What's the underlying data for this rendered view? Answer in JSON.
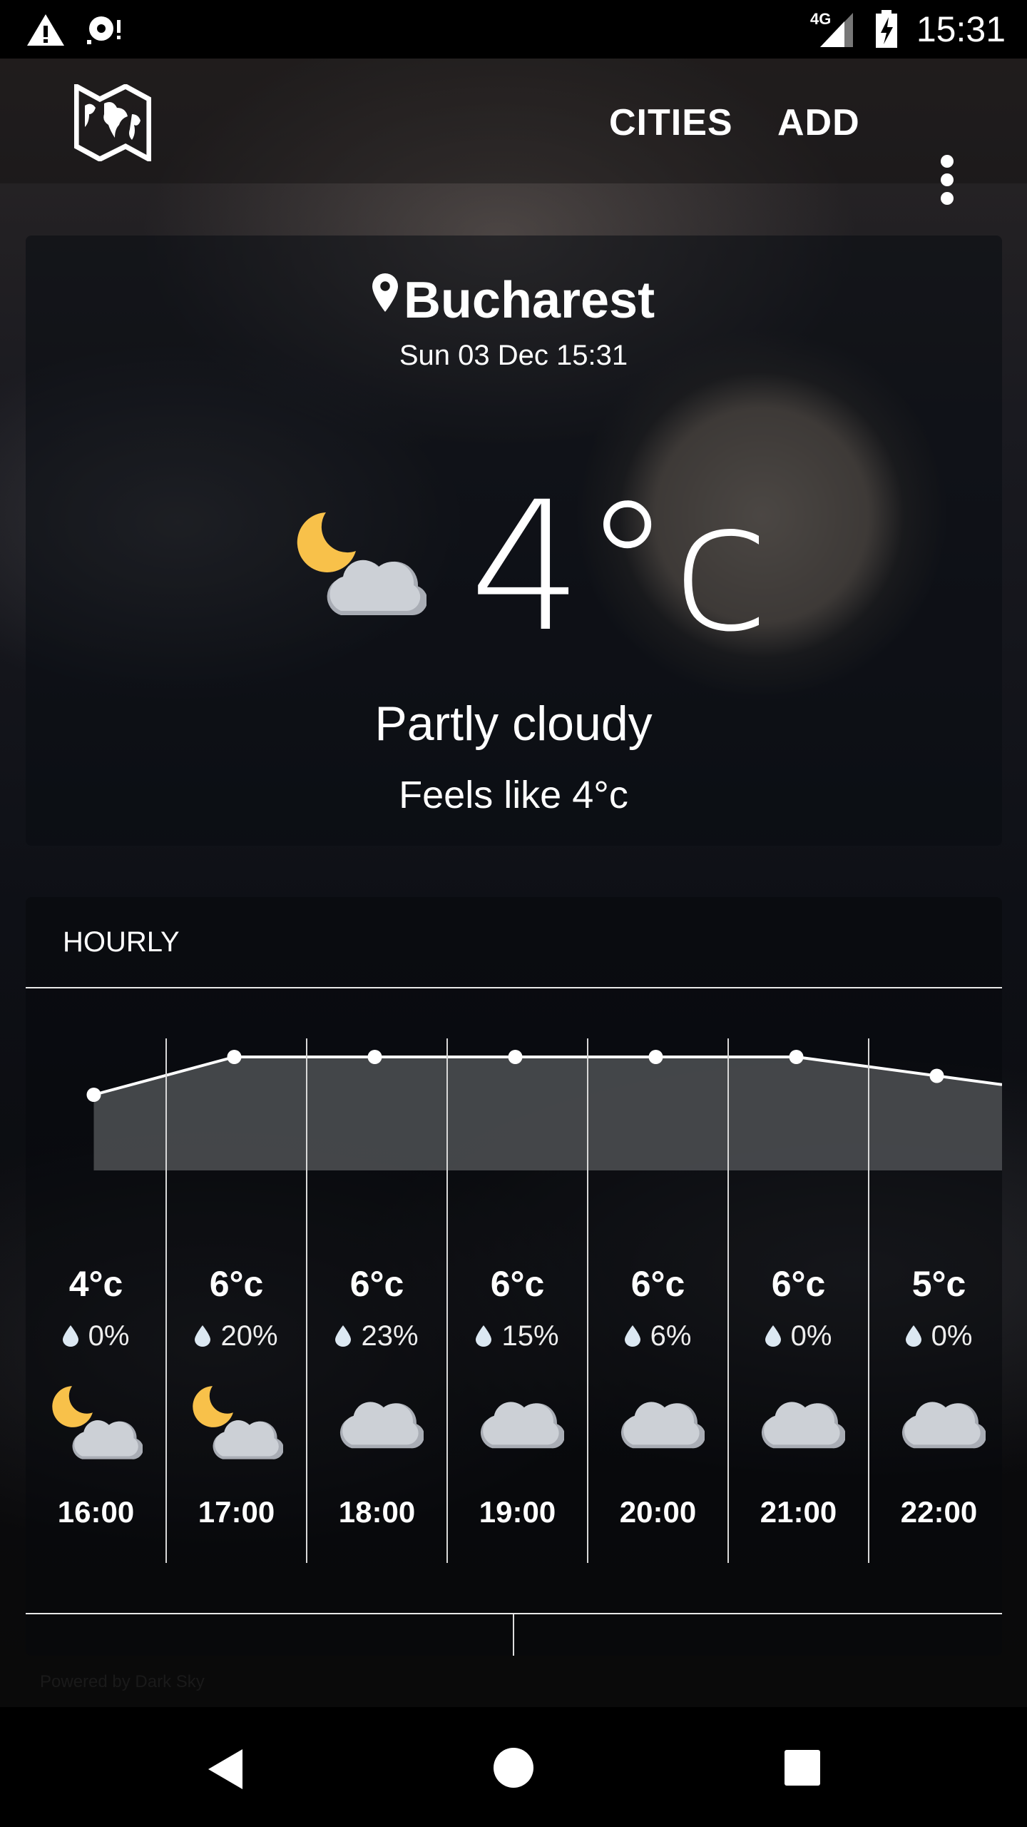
{
  "status_bar": {
    "time": "15:31",
    "network": "4G",
    "icons": [
      "warning-icon",
      "sync-alert-icon",
      "signal-icon",
      "battery-charging-icon"
    ]
  },
  "toolbar": {
    "logo": "world-map-icon",
    "cities_label": "CITIES",
    "add_label": "ADD",
    "menu_icon": "more-vert-icon"
  },
  "current": {
    "city": "Bucharest",
    "datetime": "Sun 03 Dec 15:31",
    "temperature": "4°c",
    "summary": "Partly cloudy",
    "feels_like": "Feels like 4°c",
    "icon": "partly-cloudy-night"
  },
  "hourly": {
    "label": "HOURLY",
    "items": [
      {
        "time": "16:00",
        "temp": "4°c",
        "temp_value": 4,
        "precip": "0%",
        "icon": "partly-cloudy-night"
      },
      {
        "time": "17:00",
        "temp": "6°c",
        "temp_value": 6,
        "precip": "20%",
        "icon": "partly-cloudy-night"
      },
      {
        "time": "18:00",
        "temp": "6°c",
        "temp_value": 6,
        "precip": "23%",
        "icon": "cloudy"
      },
      {
        "time": "19:00",
        "temp": "6°c",
        "temp_value": 6,
        "precip": "15%",
        "icon": "cloudy"
      },
      {
        "time": "20:00",
        "temp": "6°c",
        "temp_value": 6,
        "precip": "6%",
        "icon": "cloudy"
      },
      {
        "time": "21:00",
        "temp": "6°c",
        "temp_value": 6,
        "precip": "0%",
        "icon": "cloudy"
      },
      {
        "time": "22:00",
        "temp": "5°c",
        "temp_value": 5,
        "precip": "0%",
        "icon": "cloudy"
      }
    ]
  },
  "footer": {
    "powered_by": "Powered by Dark Sky"
  },
  "colors": {
    "moon": "#f8c14a",
    "cloud": "#ccd0d6",
    "drop": "#dce8f2",
    "chart_fill": "#4a4c50"
  }
}
